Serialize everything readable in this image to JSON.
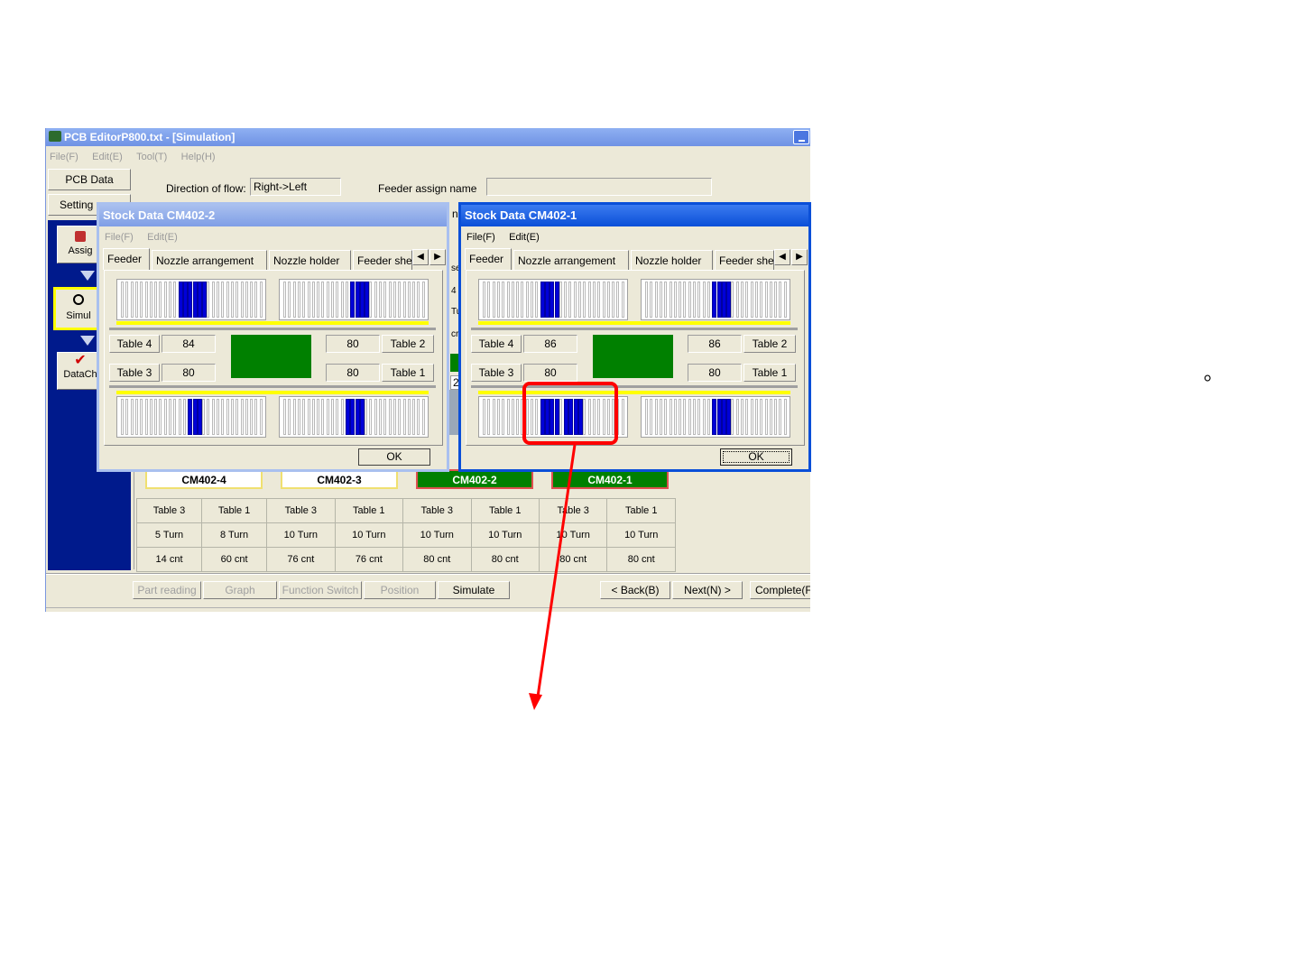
{
  "window": {
    "title": "PCB EditorP800.txt - [Simulation]",
    "menu": [
      "File(F)",
      "Edit(E)",
      "Tool(T)",
      "Help(H)"
    ]
  },
  "left_buttons": {
    "pcb_data": "PCB Data",
    "setting": "Setting"
  },
  "header": {
    "direction_label": "Direction of flow:",
    "direction_value": "Right->Left",
    "feeder_assign_label": "Feeder assign name",
    "feeder_assign_value": ""
  },
  "nav": {
    "assign": "Assig",
    "simul": "Simul",
    "datacheck": "DataCh"
  },
  "machines": [
    {
      "name": "CM402-4",
      "active": false,
      "cells": [
        [
          "Table 3",
          "Table 1"
        ],
        [
          "5 Turn",
          "8 Turn"
        ],
        [
          "14 cnt",
          "60 cnt"
        ]
      ]
    },
    {
      "name": "CM402-3",
      "active": false,
      "cells": [
        [
          "Table 3",
          "Table 1"
        ],
        [
          "10 Turn",
          "10 Turn"
        ],
        [
          "76 cnt",
          "76 cnt"
        ]
      ]
    },
    {
      "name": "CM402-2",
      "active": true,
      "cells": [
        [
          "Table 3",
          "Table 1"
        ],
        [
          "10 Turn",
          "10 Turn"
        ],
        [
          "80 cnt",
          "80 cnt"
        ]
      ]
    },
    {
      "name": "CM402-1",
      "active": true,
      "cells": [
        [
          "Table 3",
          "Table 1"
        ],
        [
          "10 Turn",
          "10 Turn"
        ],
        [
          "80 cnt",
          "80 cnt"
        ]
      ]
    }
  ],
  "bottom": {
    "part_reading": "Part reading",
    "graph": "Graph",
    "function_switch": "Function Switch",
    "position": "Position",
    "simulate": "Simulate",
    "back": "< Back(B)",
    "next": "Next(N) >",
    "complete": "Complete(F"
  },
  "behind_fragments": {
    "s": "se",
    "four": "4",
    "tu": "Tu",
    "cr": "cr",
    "n": "n",
    "tf": "27"
  },
  "dialogs": [
    {
      "title": "Stock Data CM402-2",
      "menu": [
        "File(F)",
        "Edit(E)"
      ],
      "tabs": [
        "Feeder",
        "Nozzle arrangement",
        "Nozzle holder",
        "Feeder she"
      ],
      "table4_label": "Table 4",
      "table4_value": "84",
      "table3_label": "Table 3",
      "table3_value": "80",
      "table2_label": "Table 2",
      "table2_value": "80",
      "table1_label": "Table 1",
      "table1_value": "80",
      "ok": "OK",
      "feeders": {
        "tl": [
          12,
          13,
          14,
          15,
          16,
          17
        ],
        "tr": [
          14,
          15,
          16,
          17
        ],
        "bl": [
          14,
          15,
          16
        ],
        "br": [
          13,
          14,
          15,
          16
        ]
      }
    },
    {
      "title": "Stock Data CM402-1",
      "menu": [
        "File(F)",
        "Edit(E)"
      ],
      "tabs": [
        "Feeder",
        "Nozzle arrangement",
        "Nozzle holder",
        "Feeder she"
      ],
      "table4_label": "Table 4",
      "table4_value": "86",
      "table3_label": "Table 3",
      "table3_value": "80",
      "table2_label": "Table 2",
      "table2_value": "86",
      "table1_label": "Table 1",
      "table1_value": "80",
      "ok": "OK",
      "feeders": {
        "tl": [
          12,
          13,
          14,
          15
        ],
        "tr": [
          14,
          15,
          16,
          17
        ],
        "bl": [
          12,
          13,
          14,
          15,
          17,
          18,
          19,
          20
        ],
        "br": [
          14,
          15,
          16,
          17
        ]
      }
    }
  ],
  "annotation_mark": "。",
  "colors": {
    "highlight": "#ff0000",
    "feeder_on": "#0000d8",
    "active_machine": "#008000",
    "nav_bg": "#001a8c"
  }
}
